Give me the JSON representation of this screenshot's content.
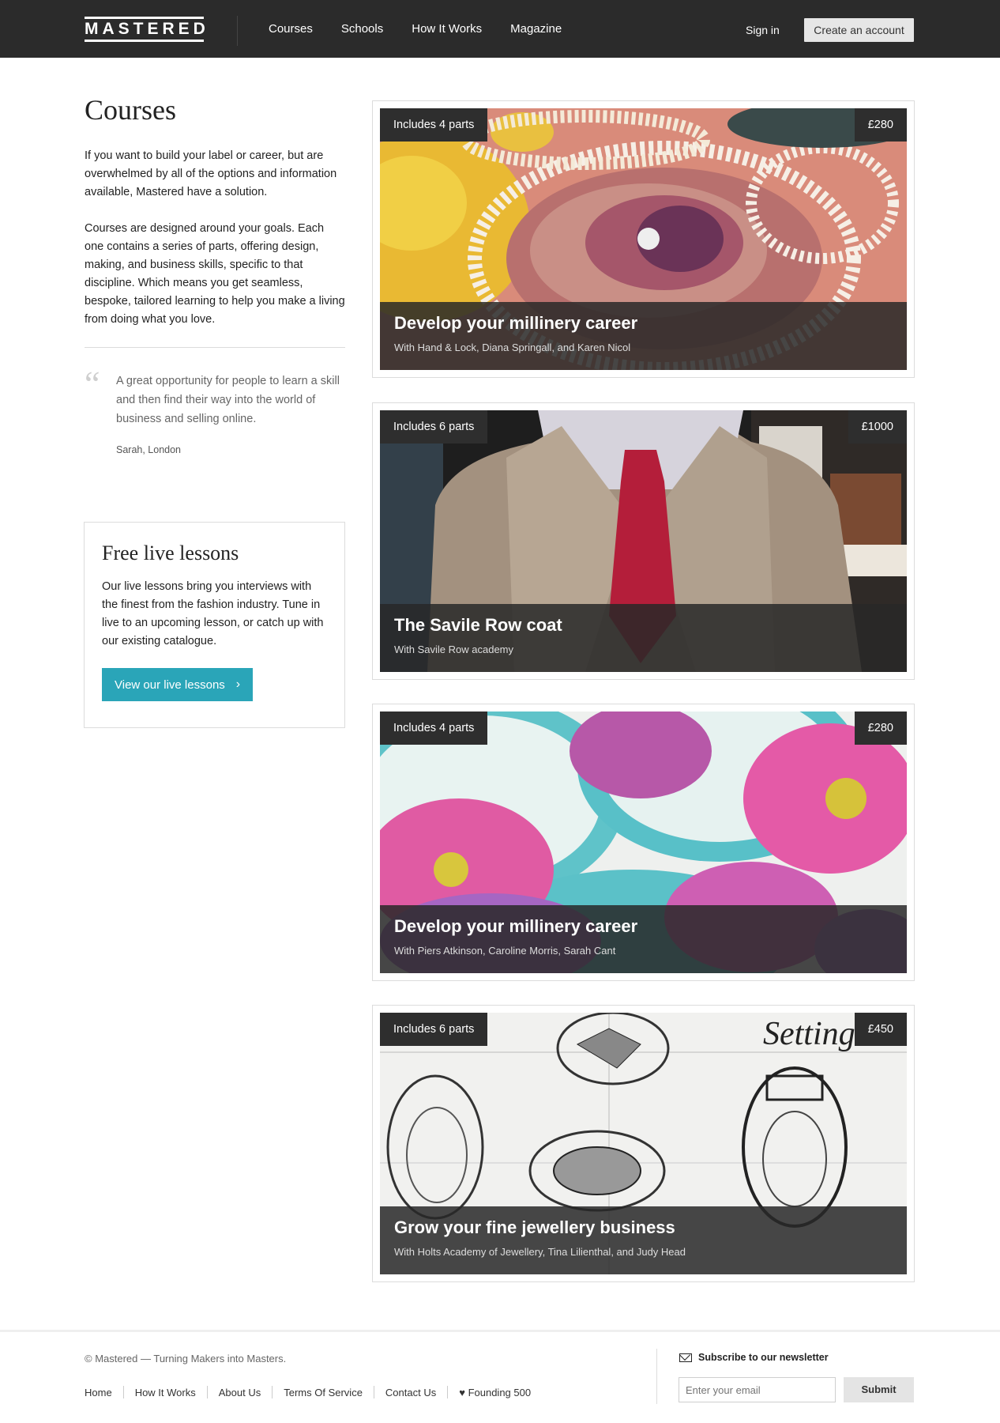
{
  "header": {
    "logo": "MASTERED",
    "nav": [
      "Courses",
      "Schools",
      "How It Works",
      "Magazine"
    ],
    "sign_in": "Sign in",
    "create_account": "Create an account"
  },
  "left": {
    "title": "Courses",
    "intro": [
      "If you want to build your label or career, but are overwhelmed by all of the options and information available, Mastered have a solution.",
      "Courses are designed around your goals. Each one contains a series of parts, offering design, making, and business skills, specific to that discipline. Which means you get seamless, bespoke, tailored learning to help you make a living from doing what you love."
    ],
    "quote_mark": "“",
    "quote": "A great opportunity for people to learn a skill and then find their way into the world of business and selling online.",
    "quote_author": "Sarah, London",
    "live": {
      "title": "Free live lessons",
      "text": "Our live lessons bring you interviews with the finest from the fashion industry. Tune in live to an upcoming lesson, or catch up with our existing catalogue.",
      "button": "View our live lessons",
      "button_icon": "chevron-right-icon"
    }
  },
  "courses": [
    {
      "parts": "Includes 4 parts",
      "price": "£280",
      "title": "Develop your millinery career",
      "subtitle": "With Hand & Lock, Diana Springall, and Karen Nicol",
      "image": "embroidery-sequins-photo"
    },
    {
      "parts": "Includes 6 parts",
      "price": "£1000",
      "title": "The Savile Row coat",
      "subtitle": "With Savile Row academy",
      "image": "tweed-jacket-photo"
    },
    {
      "parts": "Includes 4 parts",
      "price": "£280",
      "title": "Develop your millinery career",
      "subtitle": "With Piers Atkinson, Caroline Morris, Sarah Cant",
      "image": "pink-flowers-photo"
    },
    {
      "parts": "Includes 6 parts",
      "price": "£450",
      "title": "Grow your fine jewellery business",
      "subtitle": "With Holts Academy of Jewellery, Tina Lilienthal, and Judy Head",
      "image": "ring-sketches-photo",
      "image_text": "Setting"
    }
  ],
  "footer": {
    "copyright": "© Mastered — Turning Makers into Masters.",
    "links": [
      "Home",
      "How It Works",
      "About Us",
      "Terms Of Service",
      "Contact Us",
      "♥ Founding 500"
    ],
    "newsletter_label": "Subscribe to our newsletter",
    "email_placeholder": "Enter your email",
    "submit": "Submit"
  },
  "colors": {
    "topbar": "#2b2b2b",
    "accent": "#2aa5b8"
  }
}
